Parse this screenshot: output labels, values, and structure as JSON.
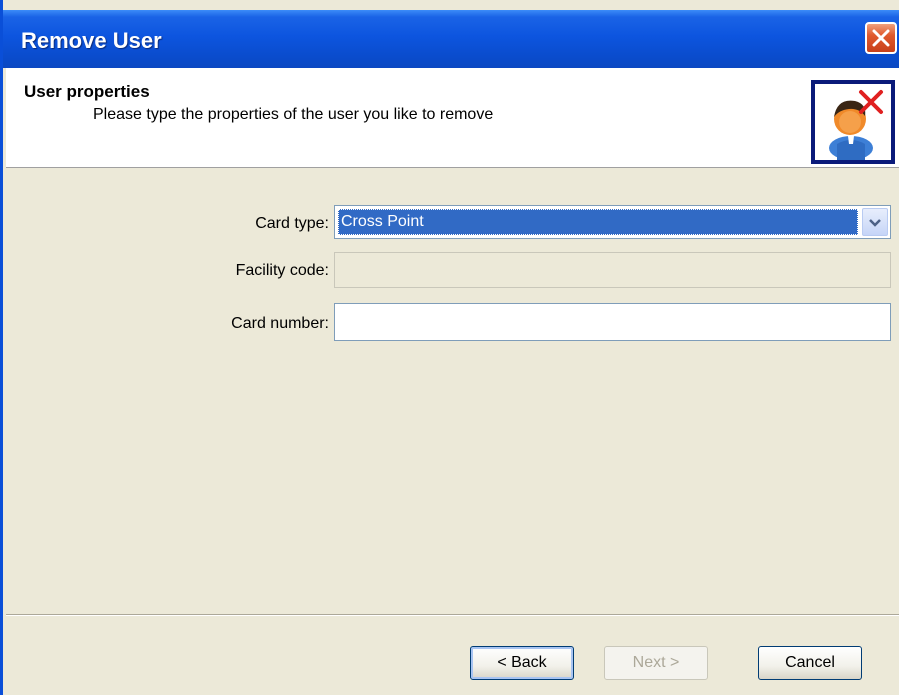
{
  "window": {
    "title": "Remove User"
  },
  "header": {
    "title": "User properties",
    "subtitle": "Please type the properties of the user you like to remove",
    "icon": "remove-user-icon"
  },
  "form": {
    "card_type": {
      "label": "Card type:",
      "value": "Cross Point"
    },
    "facility_code": {
      "label": "Facility code:",
      "value": ""
    },
    "card_number": {
      "label": "Card number:",
      "value": ""
    }
  },
  "buttons": {
    "back": "< Back",
    "next": "Next >",
    "cancel": "Cancel"
  },
  "colors": {
    "titlebar": "#0a4ccd",
    "selection": "#316ac5",
    "close": "#e05a2e"
  }
}
